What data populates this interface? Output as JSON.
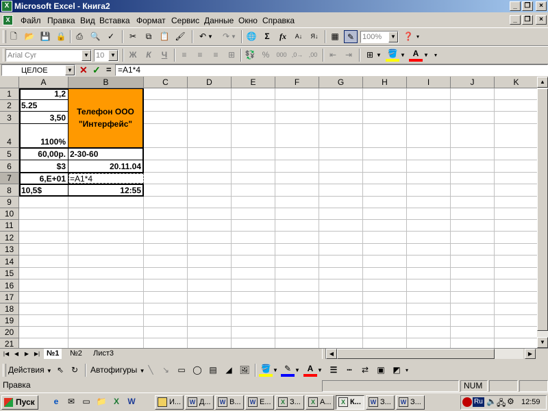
{
  "window": {
    "title": "Microsoft Excel - Книга2",
    "app_icon": "excel-icon",
    "controls": [
      "_",
      "❐",
      "×"
    ]
  },
  "menu": {
    "items": [
      "Файл",
      "Правка",
      "Вид",
      "Вставка",
      "Формат",
      "Сервис",
      "Данные",
      "Окно",
      "Справка"
    ],
    "doc_controls": [
      "_",
      "❐",
      "×"
    ]
  },
  "standard_toolbar": {
    "zoom": "100%",
    "icons": [
      "new-icon",
      "open-icon",
      "save-icon",
      "permission-icon",
      "print-icon",
      "print-preview-icon",
      "spelling-icon",
      "cut-icon",
      "copy-icon",
      "paste-icon",
      "format-painter-icon",
      "undo-icon",
      "redo-icon",
      "hyperlink-icon",
      "autosum-icon",
      "function-icon",
      "sort-asc-icon",
      "sort-desc-icon",
      "chart-wizard-icon",
      "drawing-icon",
      "help-icon"
    ]
  },
  "formatting_toolbar": {
    "font": "Arial Cyr",
    "size": "10",
    "bold": "Ж",
    "italic": "К",
    "underline": "Ч",
    "currency": "%",
    "thousands": "000",
    "fill_color": "#ffff00",
    "font_color": "#ff0000"
  },
  "formula_bar": {
    "name_box": "ЦЕЛОЕ",
    "cancel": "✕",
    "enter": "✓",
    "equals": "=",
    "formula": "=A1*4"
  },
  "sheet": {
    "columns": [
      "A",
      "B",
      "C",
      "D",
      "E",
      "F",
      "G",
      "H",
      "I",
      "J",
      "K"
    ],
    "rows": [
      "1",
      "2",
      "3",
      "4",
      "5",
      "6",
      "7",
      "8",
      "9",
      "10",
      "11",
      "12",
      "13",
      "14",
      "15",
      "16",
      "17",
      "18",
      "19",
      "20",
      "21"
    ],
    "cells": {
      "A1": "1,2",
      "A2": "5.25",
      "A3": "3,50",
      "A4": "1100%",
      "A5": "60,00р.",
      "A6": "$3",
      "A7": "6,E+01",
      "A8": "10,5$",
      "B1_line1": "Телефон ООО",
      "B1_line2": "\"Интерфейс\"",
      "B5": "2-30-60",
      "B6": "20.11.04",
      "B7": "=A1*4",
      "B8": "12:55"
    },
    "merged_fill": "#ff9900"
  },
  "sheet_tabs": [
    "№1",
    "№2",
    "Лист3"
  ],
  "draw_toolbar": {
    "actions": "Действия",
    "autoshapes": "Автофигуры"
  },
  "status_bar": {
    "mode": "Правка",
    "num": "NUM"
  },
  "taskbar": {
    "start": "Пуск",
    "tasks": [
      "И...",
      "Д...",
      "В...",
      "Е...",
      "З...",
      "А...",
      "К...",
      "З...",
      "З..."
    ],
    "lang": "Ru",
    "clock": "12:59"
  }
}
